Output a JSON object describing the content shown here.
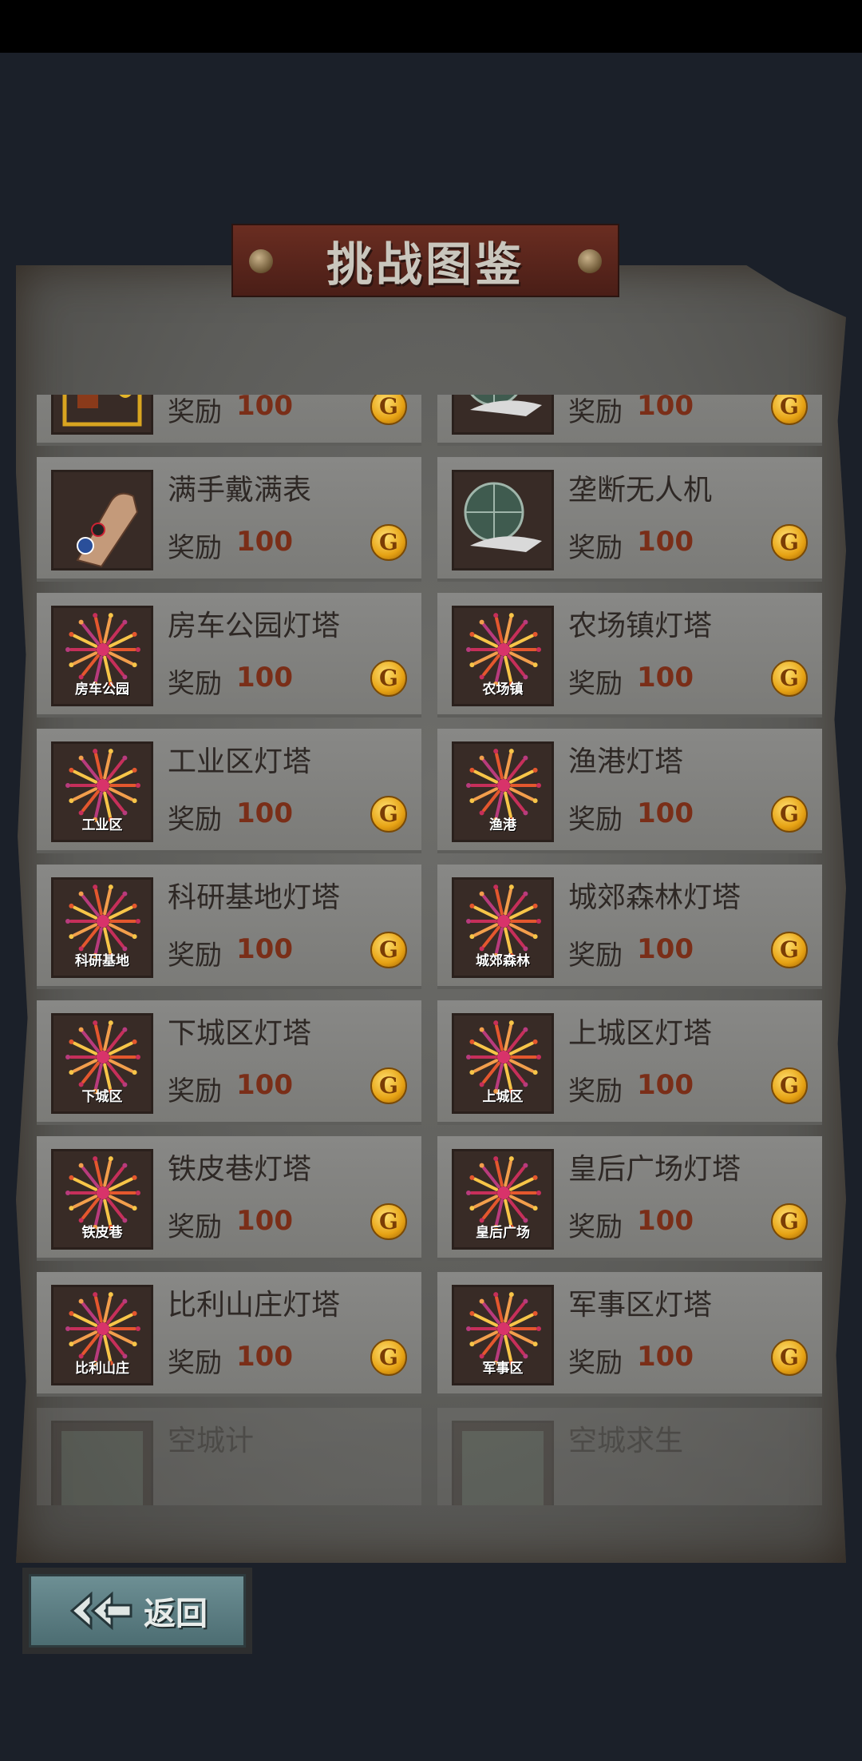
{
  "title": "挑战图鉴",
  "back_label": "返回",
  "reward_label": "奖励",
  "coin_glyph": "G",
  "items": [
    {
      "name": "",
      "reward": "100",
      "thumb_label": "",
      "icon": "trophy-shelf-icon"
    },
    {
      "name": "",
      "reward": "100",
      "thumb_label": "",
      "icon": "phone-globe-icon"
    },
    {
      "name": "满手戴满表",
      "reward": "100",
      "thumb_label": "",
      "icon": "wrist-watch-icon"
    },
    {
      "name": "垄断无人机",
      "reward": "100",
      "thumb_label": "",
      "icon": "drone-globe-icon"
    },
    {
      "name": "房车公园灯塔",
      "reward": "100",
      "thumb_label": "房车公园",
      "icon": "firework-icon"
    },
    {
      "name": "农场镇灯塔",
      "reward": "100",
      "thumb_label": "农场镇",
      "icon": "firework-icon"
    },
    {
      "name": "工业区灯塔",
      "reward": "100",
      "thumb_label": "工业区",
      "icon": "firework-icon"
    },
    {
      "name": "渔港灯塔",
      "reward": "100",
      "thumb_label": "渔港",
      "icon": "firework-icon"
    },
    {
      "name": "科研基地灯塔",
      "reward": "100",
      "thumb_label": "科研基地",
      "icon": "firework-icon"
    },
    {
      "name": "城郊森林灯塔",
      "reward": "100",
      "thumb_label": "城郊森林",
      "icon": "firework-icon"
    },
    {
      "name": "下城区灯塔",
      "reward": "100",
      "thumb_label": "下城区",
      "icon": "firework-icon"
    },
    {
      "name": "上城区灯塔",
      "reward": "100",
      "thumb_label": "上城区",
      "icon": "firework-icon"
    },
    {
      "name": "铁皮巷灯塔",
      "reward": "100",
      "thumb_label": "铁皮巷",
      "icon": "firework-icon"
    },
    {
      "name": "皇后广场灯塔",
      "reward": "100",
      "thumb_label": "皇后广场",
      "icon": "firework-icon"
    },
    {
      "name": "比利山庄灯塔",
      "reward": "100",
      "thumb_label": "比利山庄",
      "icon": "firework-icon"
    },
    {
      "name": "军事区灯塔",
      "reward": "100",
      "thumb_label": "军事区",
      "icon": "firework-icon"
    },
    {
      "name": "空城计",
      "reward": "",
      "thumb_label": "",
      "icon": "locked-empty-city-icon",
      "locked": true
    },
    {
      "name": "空城求生",
      "reward": "",
      "thumb_label": "",
      "icon": "locked-survival-map-icon",
      "locked": true
    }
  ]
}
